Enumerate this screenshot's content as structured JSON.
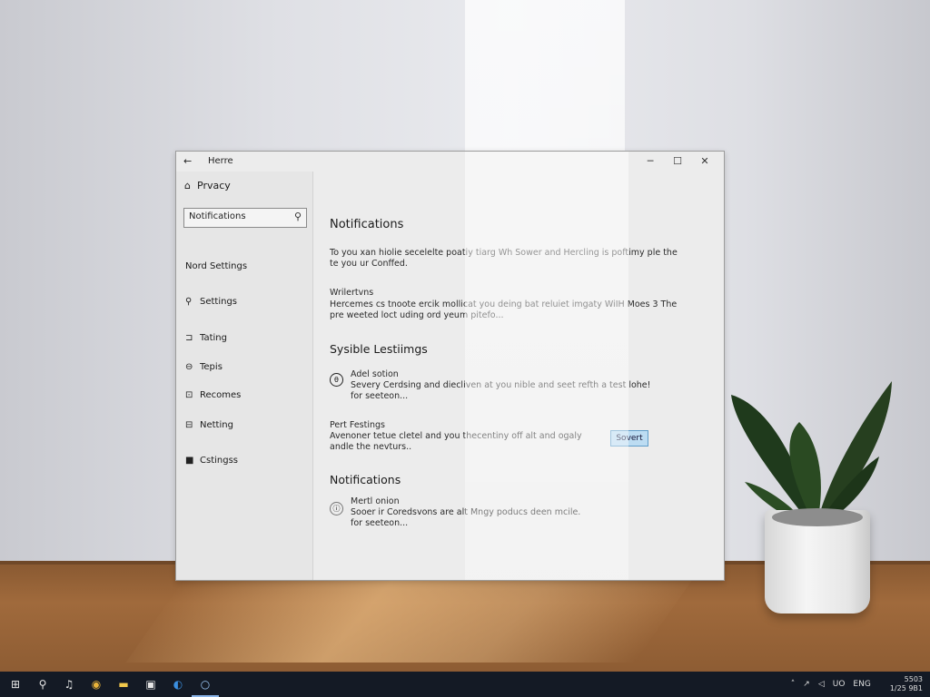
{
  "window": {
    "title": "Herre",
    "back_icon": "arrow-left-icon",
    "controls": {
      "minimize": "─",
      "maximize": "☐",
      "close": "✕"
    }
  },
  "sidebar": {
    "home_label": "Prvacy",
    "search": {
      "value": "Notifications",
      "placeholder": "Notifications"
    },
    "items": [
      {
        "label": "Nord Settings",
        "icon": ""
      },
      {
        "label": "Settings",
        "icon": "search-icon"
      },
      {
        "label": "Tating",
        "icon": "tag-icon"
      },
      {
        "label": "Tepis",
        "icon": "lock-icon"
      },
      {
        "label": "Recomes",
        "icon": "message-icon"
      },
      {
        "label": "Netting",
        "icon": "printer-icon"
      },
      {
        "label": "Cstingss",
        "icon": "lock-filled-icon"
      }
    ]
  },
  "content": {
    "heading": "Notifications",
    "intro_line1": "To you xan hiolie secelelte poatiy tiarg Wh Sower and Hercling is poftimy ple the",
    "intro_line2": "te you ur Conffed.",
    "sub_title": "Wrilertvns",
    "sub_line1": "Hercemes cs tnoote ercik mollicat you deing bat reluiet imgaty WiIH Moes 3 The",
    "sub_line2": "pre weeted loct uding ord yeum pitefo...",
    "section1_title": "Sysible Lestiimgs",
    "item1": {
      "title": "Adel sotion",
      "line1": "Severy Cerdsing and diecliven at you nible and seet refth a test lohe!",
      "line2": "for seeteon..."
    },
    "item2": {
      "title": "Pert Festings",
      "line1": "Avenoner tetue cletel and you thecentiny off alt and ogaly",
      "line2": "andle the nevturs..",
      "button": "Sovert"
    },
    "section2_title": "Notifications",
    "item3": {
      "title": "Mertl onion",
      "line1": "Sooer ir Coredsvons are alt Mngy poducs deen mcile.",
      "line2": "for seeteon..."
    }
  },
  "taskbar": {
    "buttons": [
      "windows-icon",
      "search-icon",
      "music-icon",
      "chrome-icon",
      "file-explorer-icon",
      "store-icon",
      "edge-icon",
      "cortana-icon"
    ],
    "tray": [
      "chevron-up-icon",
      "network-icon",
      "volume-icon",
      "battery-icon"
    ],
    "tray_text": "UO",
    "tray_text2": "ENG",
    "time": "5503",
    "date": "1/25 9B1"
  },
  "colors": {
    "taskbar_bg": "#141a25",
    "button_bg": "#bcdcf2",
    "window_bg": "#ececec"
  }
}
